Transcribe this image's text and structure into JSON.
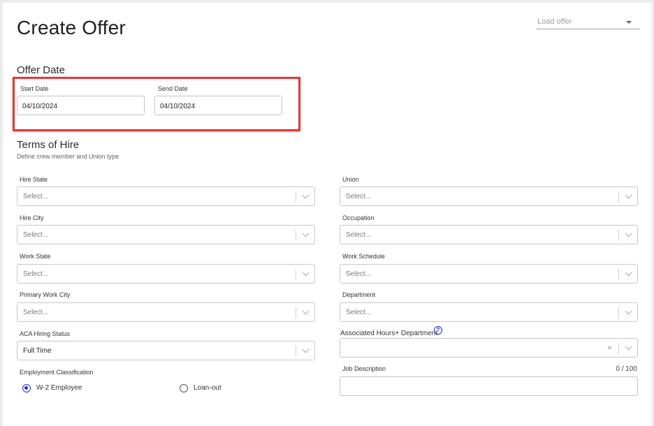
{
  "page": {
    "title": "Create Offer"
  },
  "load_offer": {
    "placeholder": "Load offer"
  },
  "offer_date": {
    "heading": "Offer Date",
    "start_label": "Start Date",
    "start_value": "04/10/2024",
    "send_label": "Send Date",
    "send_value": "04/10/2024"
  },
  "terms": {
    "heading": "Terms of Hire",
    "subheading": "Define crew member and Union type",
    "left_fields": [
      {
        "label": "Hire State",
        "value": "Select..."
      },
      {
        "label": "Hire City",
        "value": "Select..."
      },
      {
        "label": "Work State",
        "value": "Select..."
      },
      {
        "label": "Primary Work City",
        "value": "Select..."
      },
      {
        "label": "ACA Hiring Status",
        "value": "Full Time"
      }
    ],
    "right_fields": [
      {
        "label": "Union",
        "value": "Select..."
      },
      {
        "label": "Occupation",
        "value": "Select..."
      },
      {
        "label": "Work Schedule",
        "value": "Select..."
      },
      {
        "label": "Department",
        "value": "Select..."
      }
    ],
    "associated": {
      "label": "Associated Hours+ Department",
      "clear": "×",
      "help": "?"
    },
    "employment": {
      "label": "Employment Classification",
      "options": [
        {
          "label": "W-2 Employee",
          "selected": true
        },
        {
          "label": "Loan-out",
          "selected": false
        }
      ]
    },
    "job_description": {
      "label": "Job Description",
      "counter": "0 / 100"
    }
  },
  "colors": {
    "highlight": "#e53935",
    "radio_accent": "#1a2fd6"
  }
}
